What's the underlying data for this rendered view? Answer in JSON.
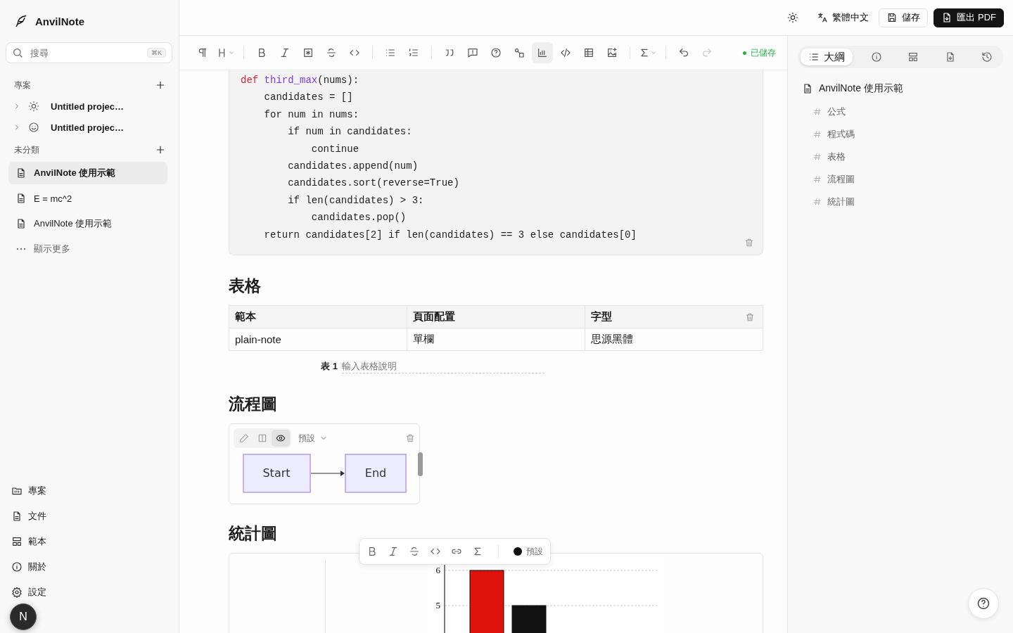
{
  "app": {
    "name": "AnvilNote"
  },
  "sidebar": {
    "search": {
      "placeholder": "搜尋",
      "shortcut": "⌘K"
    },
    "projects": {
      "title": "專案",
      "items": [
        {
          "label": "Untitled projec…",
          "expanded": false
        },
        {
          "label": "Untitled projec…",
          "expanded": false
        }
      ]
    },
    "uncategorized": {
      "title": "未分類",
      "items": [
        {
          "label": "AnvilNote 使用示範",
          "selected": true
        },
        {
          "label": "E = mc^2",
          "selected": false
        },
        {
          "label": "AnvilNote 使用示範",
          "selected": false
        }
      ],
      "more": "顯示更多"
    },
    "nav": [
      "專案",
      "文件",
      "範本",
      "關於",
      "設定"
    ],
    "avatar": {
      "initial": "N"
    }
  },
  "topbar": {
    "language": "繁體中文",
    "save": "儲存",
    "export": "匯出 PDF"
  },
  "editor_toolbar": {
    "buttons": [
      {
        "selected": false,
        "disabled": false
      },
      {
        "selected": false,
        "disabled": false
      },
      {
        "selected": false,
        "disabled": false
      },
      {
        "selected": false,
        "disabled": false
      },
      {
        "selected": false,
        "disabled": false
      },
      {
        "selected": false,
        "disabled": false
      },
      {
        "selected": false,
        "disabled": false
      },
      {
        "selected": false,
        "disabled": false
      },
      {
        "selected": false,
        "disabled": false
      },
      {
        "selected": false,
        "disabled": false
      },
      {
        "selected": false,
        "disabled": false
      },
      {
        "selected": false,
        "disabled": false
      },
      {
        "selected": false,
        "disabled": false
      },
      {
        "selected": true,
        "disabled": false
      },
      {
        "selected": false,
        "disabled": false
      },
      {
        "selected": false,
        "disabled": false
      },
      {
        "selected": false,
        "disabled": false
      },
      {
        "selected": false,
        "disabled": false
      },
      {
        "selected": false,
        "disabled": false
      },
      {
        "selected": false,
        "disabled": true
      }
    ],
    "status": "已儲存"
  },
  "code_block": {
    "lines": [
      [
        {
          "kind": "keyword",
          "text": "def"
        },
        {
          "kind": "function",
          "text": " third_max"
        },
        {
          "kind": "plain",
          "text": "(nums):"
        }
      ],
      [
        {
          "kind": "plain",
          "text": "    candidates = []"
        }
      ],
      [
        {
          "kind": "plain",
          "text": "    for num in nums:"
        }
      ],
      [
        {
          "kind": "plain",
          "text": "        if num in candidates:"
        }
      ],
      [
        {
          "kind": "plain",
          "text": "            continue"
        }
      ],
      [
        {
          "kind": "plain",
          "text": "        candidates.append(num)"
        }
      ],
      [
        {
          "kind": "plain",
          "text": "        candidates.sort(reverse=True)"
        }
      ],
      [
        {
          "kind": "plain",
          "text": "        if len(candidates) > 3:"
        }
      ],
      [
        {
          "kind": "plain",
          "text": "            candidates.pop()"
        }
      ],
      [
        {
          "kind": "plain",
          "text": "    return candidates[2] if len(candidates) == 3 else candidates[0]"
        }
      ]
    ]
  },
  "table_section": {
    "heading": "表格",
    "columns": [
      "範本",
      "頁面配置",
      "字型"
    ],
    "rows": [
      [
        "plain-note",
        "單欄",
        "思源黑體"
      ]
    ],
    "caption": {
      "label": "表 1",
      "placeholder": "輸入表格說明"
    }
  },
  "flow_section": {
    "heading": "流程圖",
    "modes": [
      {
        "selected": false
      },
      {
        "selected": false
      },
      {
        "selected": true
      }
    ],
    "theme": "預設",
    "nodes": [
      "Start",
      "End"
    ]
  },
  "chart_section": {
    "heading": "統計圖",
    "chart_data": {
      "type": "bar",
      "ylim": [
        0,
        6.2
      ],
      "yticks": [
        5,
        6
      ],
      "series": [
        {
          "color": "#e0120c",
          "values": [
            6
          ]
        },
        {
          "color": "#111111",
          "values": [
            5
          ]
        }
      ]
    }
  },
  "format_toolbar": {
    "color_label": "預設"
  },
  "right_panel": {
    "tabs": [
      {
        "label": "大綱",
        "selected": true
      },
      {
        "selected": false
      },
      {
        "selected": false
      },
      {
        "selected": false
      },
      {
        "selected": false
      }
    ],
    "outline": {
      "title": "AnvilNote 使用示範",
      "headings": [
        "公式",
        "程式碼",
        "表格",
        "流程圖",
        "統計圖"
      ]
    }
  }
}
